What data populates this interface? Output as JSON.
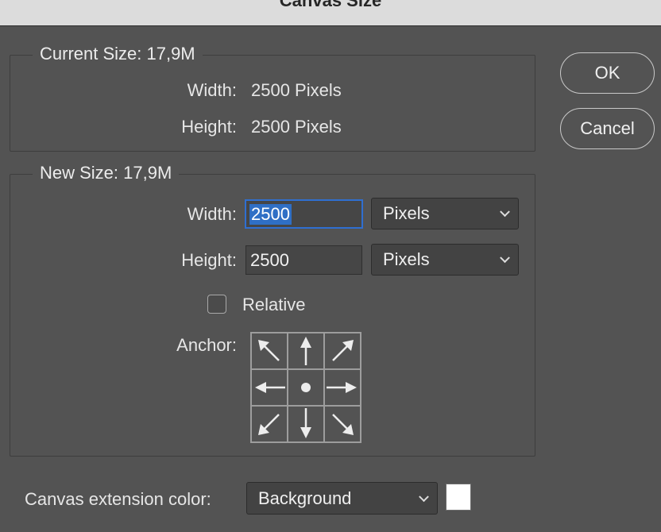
{
  "window": {
    "title": "Canvas Size"
  },
  "current_size": {
    "legend": "Current Size: 17,9M",
    "width_label": "Width:",
    "width_value": "2500 Pixels",
    "height_label": "Height:",
    "height_value": "2500 Pixels"
  },
  "new_size": {
    "legend": "New Size: 17,9M",
    "width_label": "Width:",
    "width_value": "2500",
    "width_unit": "Pixels",
    "height_label": "Height:",
    "height_value": "2500",
    "height_unit": "Pixels",
    "relative_label": "Relative",
    "relative_checked": false,
    "anchor_label": "Anchor:",
    "anchor_icons": [
      "arrow-up-left-icon",
      "arrow-up-icon",
      "arrow-up-right-icon",
      "arrow-left-icon",
      "anchor-center-dot-icon",
      "arrow-right-icon",
      "arrow-down-left-icon",
      "arrow-down-icon",
      "arrow-down-right-icon"
    ]
  },
  "buttons": {
    "ok": "OK",
    "cancel": "Cancel"
  },
  "extension": {
    "label": "Canvas extension color:",
    "value": "Background",
    "swatch_color": "#ffffff"
  }
}
